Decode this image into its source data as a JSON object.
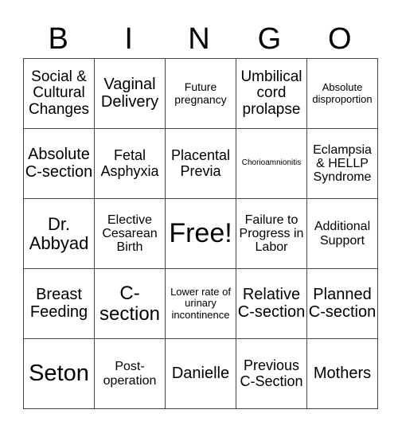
{
  "header": [
    "B",
    "I",
    "N",
    "G",
    "O"
  ],
  "board": [
    [
      "Social & Cultural Changes",
      "Vaginal Delivery",
      "Future pregnancy",
      "Umbilical cord prolapse",
      "Absolute disproportion"
    ],
    [
      "Absolute C-section",
      "Fetal Asphyxia",
      "Placental Previa",
      "Chorioamnionitis",
      "Eclampsia & HELLP Syndrome"
    ],
    [
      "Dr. Abbyad",
      "Elective Cesarean Birth",
      "Free!",
      "Failure to Progress in Labor",
      "Additional Support"
    ],
    [
      "Breast Feeding",
      "C-section",
      "Lower rate of urinary incontinence",
      "Relative C-section",
      "Planned C-section"
    ],
    [
      "Seton",
      "Post-operation",
      "Danielle",
      "Previous C-Section",
      "Mothers"
    ]
  ]
}
